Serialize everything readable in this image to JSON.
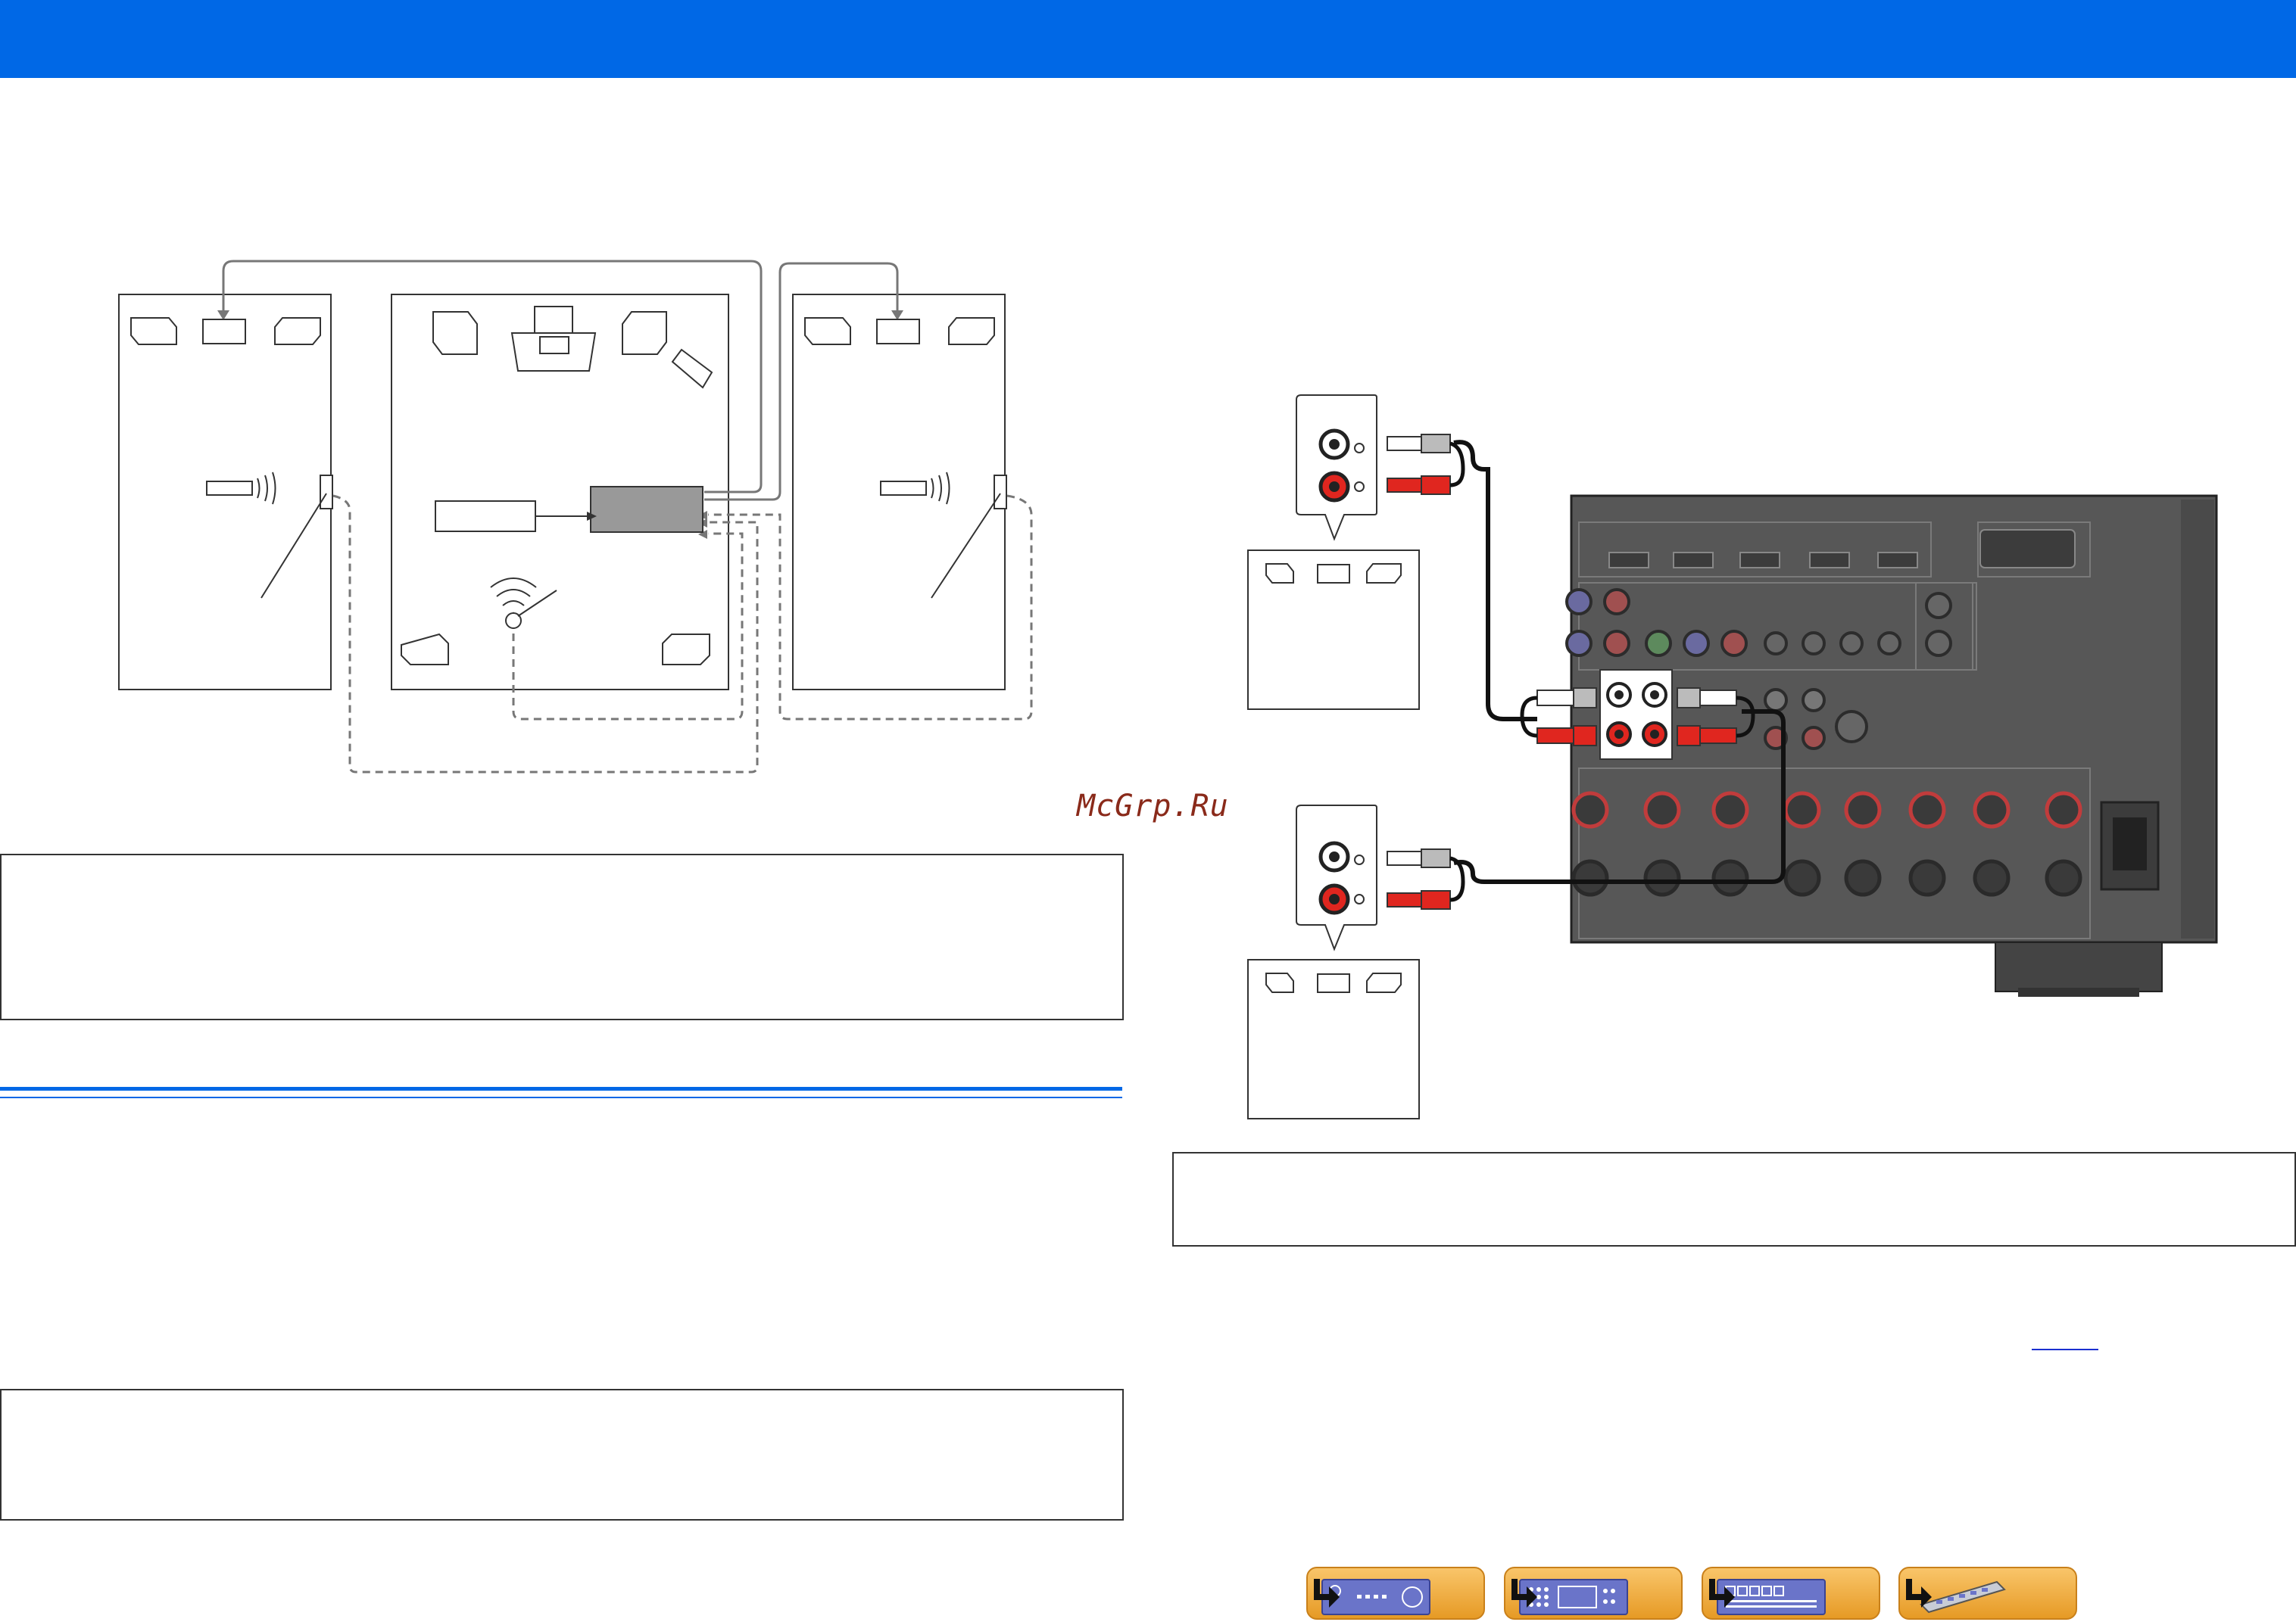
{
  "watermark": "McGrp.Ru",
  "nav": [
    {
      "icon": "front-panel-icon"
    },
    {
      "icon": "rear-panel-icon"
    },
    {
      "icon": "front-display-icon"
    },
    {
      "icon": "remote-control-icon"
    }
  ],
  "colors": {
    "header": "#0068e6",
    "rule": "#0068e6",
    "receiver": "#565656",
    "cable_red": "#e0261f",
    "nav_button": "#f0ad3e"
  }
}
